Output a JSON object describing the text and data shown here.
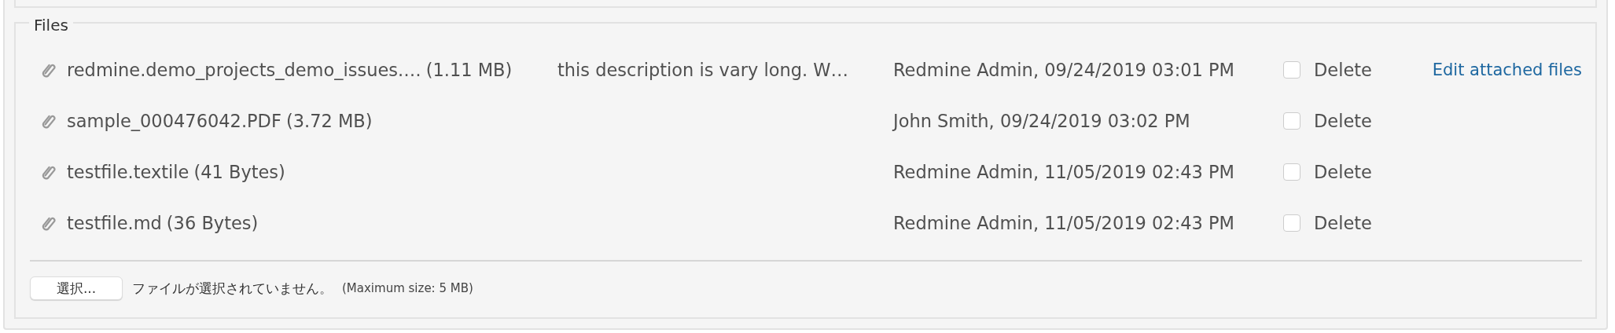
{
  "fieldset": {
    "legend": "Files",
    "attachments": [
      {
        "filename": "redmine.demo_projects_demo_issues.…",
        "size": "(1.11 MB)",
        "description": "this description is vary long. W…",
        "author": "Redmine Admin, 09/24/2019 03:01 PM",
        "delete_label": "Delete",
        "checked": false
      },
      {
        "filename": "sample_000476042.PDF",
        "size": "(3.72 MB)",
        "author": "John Smith, 09/24/2019 03:02 PM",
        "delete_label": "Delete",
        "checked": false
      },
      {
        "filename": "testfile.textile",
        "size": "(41 Bytes)",
        "author": "Redmine Admin, 11/05/2019 02:43 PM",
        "delete_label": "Delete",
        "checked": false
      },
      {
        "filename": "testfile.md",
        "size": "(36 Bytes)",
        "author": "Redmine Admin, 11/05/2019 02:43 PM",
        "delete_label": "Delete",
        "checked": false
      }
    ],
    "edit_link": "Edit attached files",
    "choose_button": "選択...",
    "no_file_text": "ファイルが選択されていません。",
    "max_size": "(Maximum size: 5 MB)"
  }
}
